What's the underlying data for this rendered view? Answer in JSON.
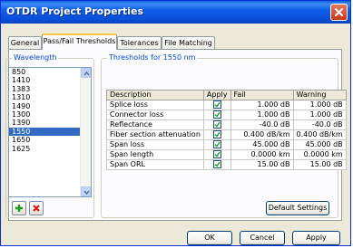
{
  "window": {
    "title": "OTDR Project Properties"
  },
  "tabs": [
    {
      "label": "General",
      "active": false
    },
    {
      "label": "Pass/Fail Thresholds",
      "active": true
    },
    {
      "label": "Tolerances",
      "active": false
    },
    {
      "label": "File Matching",
      "active": false
    }
  ],
  "wavelength": {
    "label": "Wavelength",
    "items": [
      "850",
      "1410",
      "1383",
      "1310",
      "1490",
      "1300",
      "1390",
      "1550",
      "1650",
      "1625"
    ],
    "selected": "1550"
  },
  "thresholds": {
    "label": "Thresholds for 1550 nm",
    "columns": [
      "Description",
      "Apply",
      "Fail",
      "Warning"
    ],
    "rows": [
      {
        "description": "Splice loss",
        "apply": true,
        "fail": "1.000 dB",
        "warning": "1.000 dB"
      },
      {
        "description": "Connector loss",
        "apply": true,
        "fail": "1.000 dB",
        "warning": "1.000 dB"
      },
      {
        "description": "Reflectance",
        "apply": true,
        "fail": "-40.0 dB",
        "warning": "-40.0 dB"
      },
      {
        "description": "Fiber section attenuation",
        "apply": true,
        "fail": "0.400 dB/km",
        "warning": "0.400 dB/km"
      },
      {
        "description": "Span loss",
        "apply": true,
        "fail": "45.000 dB",
        "warning": "45.000 dB"
      },
      {
        "description": "Span length",
        "apply": true,
        "fail": "0.0000 km",
        "warning": "0.0000 km"
      },
      {
        "description": "Span ORL",
        "apply": true,
        "fail": "15.00 dB",
        "warning": "15.00 dB"
      }
    ],
    "default_button": "Default Settings"
  },
  "buttons": {
    "ok": "OK",
    "cancel": "Cancel",
    "apply": "Apply"
  },
  "icons": {
    "close": "close-icon",
    "add": "add-icon",
    "remove": "remove-icon",
    "check": "check-icon",
    "scroll_up": "scroll-up-icon",
    "scroll_down": "scroll-down-icon"
  },
  "colors": {
    "title_bar": "#0a4fd8",
    "selection": "#316ac5",
    "group_label": "#0046d5",
    "check_green": "#21a121",
    "add_green": "#1a9a1a",
    "remove_red": "#d81a1a"
  }
}
